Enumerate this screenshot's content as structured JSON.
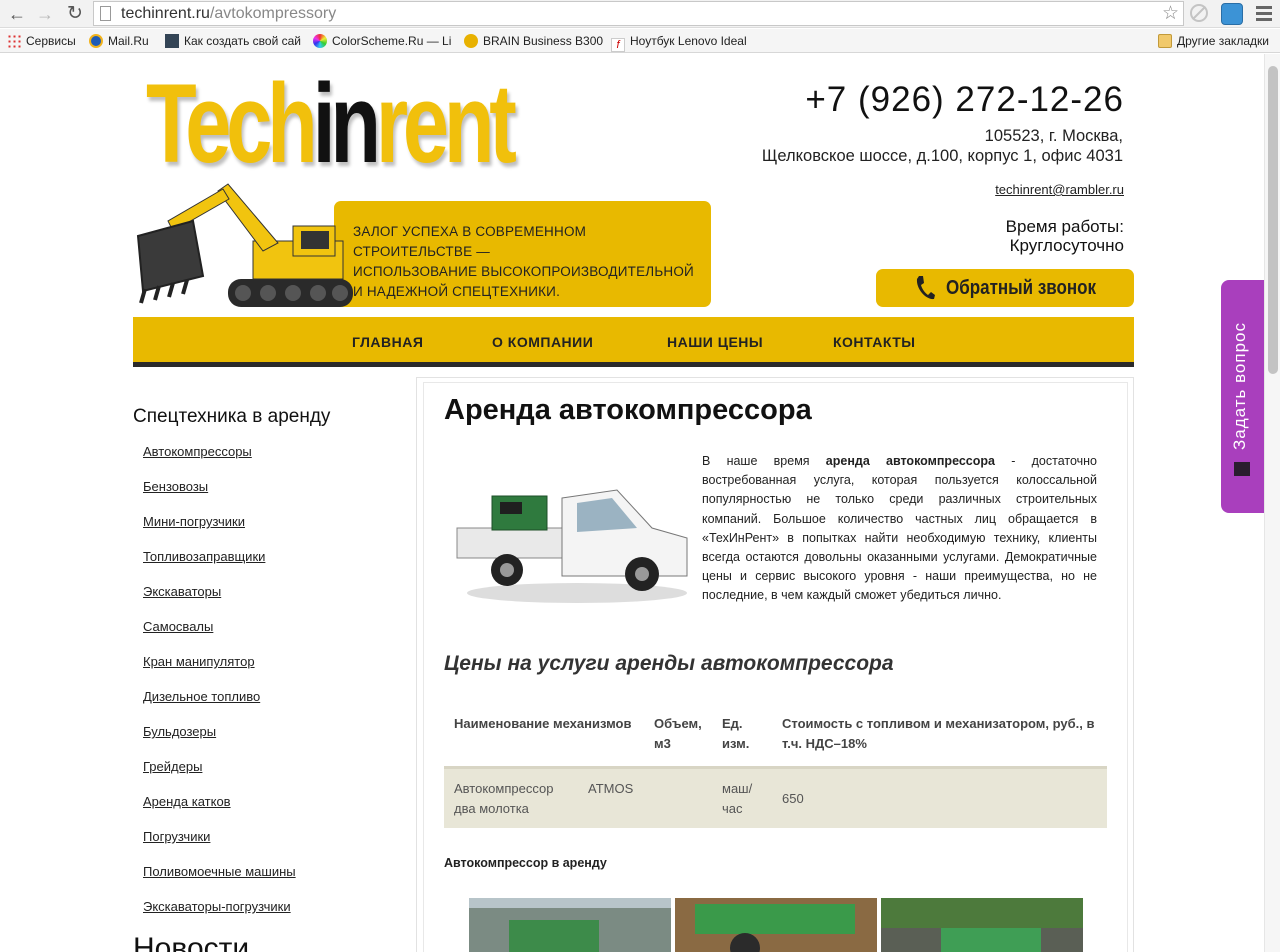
{
  "browser": {
    "url_host": "techinrent.ru",
    "url_path": "/avtokompressory",
    "bookmarks": [
      {
        "label": "Сервисы",
        "icon": "apps-icon"
      },
      {
        "label": "Mail.Ru",
        "icon": "mailru-icon"
      },
      {
        "label": "Как создать свой сай",
        "icon": "page-icon"
      },
      {
        "label": "ColorScheme.Ru — Li",
        "icon": "colorwheel-icon"
      },
      {
        "label": "BRAIN Business B300",
        "icon": "brain-icon"
      },
      {
        "label": "Ноутбук Lenovo Ideal",
        "icon": "lenovo-icon"
      }
    ],
    "other_bookmarks": "Другие закладки"
  },
  "header": {
    "logo_pre": "Tech",
    "logo_mid": "in",
    "logo_post": "rent",
    "slogan_line1": "ЗАЛОГ УСПЕХА В СОВРЕМЕННОМ СТРОИТЕЛЬСТВЕ —",
    "slogan_line2": "ИСПОЛЬЗОВАНИЕ ВЫСОКОПРОИЗВОДИТЕЛЬНОЙ",
    "slogan_line3": "И НАДЕЖНОЙ СПЕЦТЕХНИКИ.",
    "phone": "+7 (926) 272-12-26",
    "address_line1": "105523, г. Москва,",
    "address_line2": "Щелковское шоссе, д.100, корпус 1, офис 4031",
    "email": "techinrent@rambler.ru",
    "hours_label": "Время работы:",
    "hours_value": "Круглосуточно",
    "callback": "Обратный звонок"
  },
  "nav": [
    {
      "label": "ГЛАВНАЯ"
    },
    {
      "label": "О КОМПАНИИ"
    },
    {
      "label": "НАШИ ЦЕНЫ"
    },
    {
      "label": "КОНТАКТЫ"
    }
  ],
  "sidebar": {
    "title": "Спецтехника в аренду",
    "items": [
      {
        "label": "Автокомпрессоры"
      },
      {
        "label": "Бензовозы"
      },
      {
        "label": "Мини-погрузчики"
      },
      {
        "label": "Топливозаправщики"
      },
      {
        "label": "Экскаваторы"
      },
      {
        "label": "Самосвалы"
      },
      {
        "label": "Кран манипулятор"
      },
      {
        "label": "Дизельное топливо"
      },
      {
        "label": "Бульдозеры"
      },
      {
        "label": "Грейдеры"
      },
      {
        "label": "Аренда катков"
      },
      {
        "label": "Погрузчики"
      },
      {
        "label": "Поливомоечные машины"
      },
      {
        "label": "Экскаваторы-погрузчики"
      }
    ],
    "news_title": "Новости"
  },
  "main": {
    "title": "Аренда автокомпрессора",
    "para_before_bold": "В наше время ",
    "para_bold": "аренда автокомпрессора",
    "para_after_bold": " - достаточно востребованная услуга, которая пользуется колоссальной популярностью не только среди различных строительных компаний. Большое количество частных лиц обращается в «ТехИнРент» в попытках найти необходимую технику, клиенты всегда остаются довольны оказанными услугами. Демократичные цены и сервис высокого уровня - наши преимущества, но не последние, в чем каждый сможет убедиться лично.",
    "prices_title": "Цены на услуги аренды автокомпрессора",
    "table": {
      "headers": [
        "Наименование механизмов",
        "Объем, м3",
        "Ед. изм.",
        "Стоимость с топливом и механизатором, руб., в т.ч. НДС–18%"
      ],
      "row": {
        "name": "Автокомпрессор два молотка",
        "model": "ATMOS",
        "unit": "маш/час",
        "price": "650"
      }
    },
    "subtitle": "Автокомпрессор в аренду"
  },
  "side_tab": {
    "label": "Задать вопрос"
  },
  "colors": {
    "brand_yellow": "#e8b900",
    "nav_border": "#2a2a2a",
    "ask_tab": "#a93fbd",
    "table_row": "#e8e6d7"
  }
}
